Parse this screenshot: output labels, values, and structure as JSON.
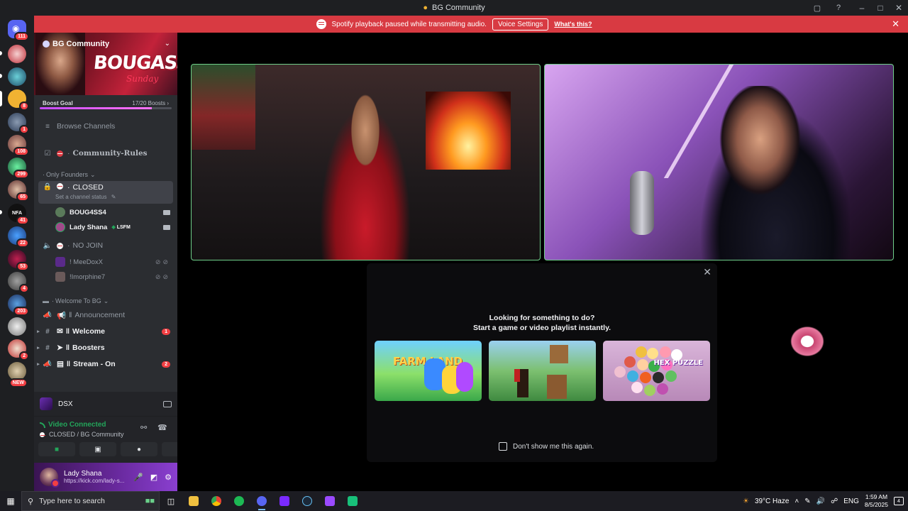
{
  "window": {
    "title": "BG Community"
  },
  "notice": {
    "text": "Spotify playback paused while transmitting audio.",
    "button": "Voice Settings",
    "link": "What's this?"
  },
  "rail": {
    "home_badge": "111",
    "servers": [
      {
        "badge": ""
      },
      {
        "badge": ""
      },
      {
        "badge": "8"
      },
      {
        "badge": "1"
      },
      {
        "badge": "108"
      },
      {
        "badge": "299"
      },
      {
        "badge": "65"
      },
      {
        "badge": "41"
      },
      {
        "badge": "22"
      },
      {
        "badge": "53"
      },
      {
        "badge": "4"
      },
      {
        "badge": "203"
      },
      {
        "badge": "2"
      },
      {
        "badge": "NEW"
      }
    ]
  },
  "server": {
    "name": "BG Community",
    "banner_title": "BOUGASSAA",
    "banner_sub": "Sunday",
    "boost_label": "Boost Goal",
    "boost_count": "17/20 Boosts",
    "boost_fraction": 0.85
  },
  "channels": {
    "browse": "Browse Channels",
    "rules": "Community-Rules",
    "cat_founders": "Only Founders",
    "closed": "CLOSED",
    "closed_status": "Set a channel status",
    "user1": "BOUG4SS4",
    "user2": "Lady Shana",
    "user2_tag": "LSFM",
    "no_join": "NO JOIN",
    "user3": "! MeeDoxX",
    "user4": "!Imorphine7",
    "cat_welcome": "Welcome To BG",
    "announcement": "Announcement",
    "welcome": "Welcome",
    "welcome_unread": "1",
    "boosters": "Boosters",
    "stream": "Stream - On",
    "stream_unread": "2"
  },
  "dsx": {
    "name": "DSX"
  },
  "voice": {
    "status": "Video Connected",
    "location": "CLOSED / BG Community"
  },
  "user": {
    "name": "Lady Shana",
    "status": "https://kick.com/lady-s..."
  },
  "popup": {
    "line1": "Looking for something to do?",
    "line2": "Start a game or video playlist instantly.",
    "cards": [
      {
        "label": "FARM LAND"
      },
      {
        "label": ""
      },
      {
        "label": "HEX PUZZLE"
      }
    ],
    "checkbox": "Don't show me this again."
  },
  "taskbar": {
    "search_placeholder": "Type here to search",
    "weather": "39°C  Haze",
    "lang": "ENG",
    "time": "1:59 AM",
    "date": "8/5/2025",
    "notif_count": "4"
  },
  "colors": {
    "notice_red": "#d83a42",
    "connected_green": "#23a55a",
    "tile_border": "#6fcf8a",
    "unread_red": "#f23f43"
  }
}
